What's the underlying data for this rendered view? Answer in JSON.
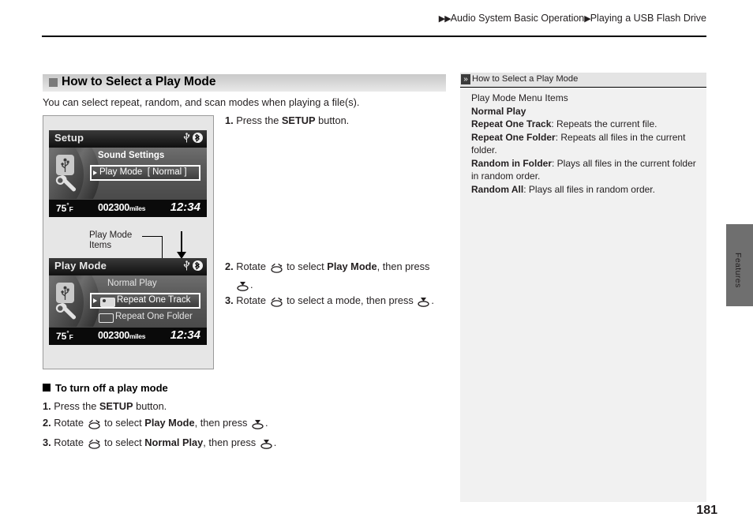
{
  "breadcrumb": {
    "arrow": "▶▶",
    "part1": "Audio System Basic Operation",
    "sep": "▶",
    "part2": "Playing a USB Flash Drive"
  },
  "heading": "How to Select a Play Mode",
  "intro": "You can select repeat, random, and scan modes when playing a file(s).",
  "screens": {
    "one": {
      "title": "Setup",
      "section_label": "Sound Settings",
      "row_label": "Play Mode",
      "row_value": "[  Normal  ]",
      "status": {
        "temp": "75",
        "degree": "°",
        "temp_unit": "F",
        "odometer": "002300",
        "odo_unit": "miles",
        "clock": "12:34"
      }
    },
    "two": {
      "title": "Play Mode",
      "items": [
        {
          "label": "Normal Play",
          "icon": "none",
          "selected": false
        },
        {
          "label": "Repeat One Track",
          "icon": "repeat-one-track-icon",
          "selected": true
        },
        {
          "label": "Repeat One Folder",
          "icon": "repeat-one-folder-icon",
          "selected": false
        }
      ],
      "status": {
        "temp": "75",
        "degree": "°",
        "temp_unit": "F",
        "odometer": "002300",
        "odo_unit": "miles",
        "clock": "12:34"
      }
    }
  },
  "callout": {
    "line1": "Play Mode",
    "line2": "Items"
  },
  "steps": {
    "step1_num": "1.",
    "step1_a": "Press the ",
    "step1_b": "SETUP",
    "step1_c": " button.",
    "step2_num": "2.",
    "step2_a": "Rotate ",
    "step2_b": " to select ",
    "step2_c": "Play Mode",
    "step2_d": ", then press ",
    "step2_e": "",
    "step3_num": "3.",
    "step3_a": "Rotate ",
    "step3_b": " to select a mode, then press ",
    "step3_c": "."
  },
  "turn_off": {
    "heading": "To turn off a play mode",
    "item1_num": "1.",
    "item1_a": "Press the ",
    "item1_b": "SETUP",
    "item1_c": " button.",
    "item2_num": "2.",
    "item2_a": "Rotate ",
    "item2_b": " to select ",
    "item2_c": "Play Mode",
    "item2_d": ", then press ",
    "item2_e": ".",
    "item3_num": "3.",
    "item3_a": "Rotate ",
    "item3_b": " to select ",
    "item3_c": "Normal Play",
    "item3_d": ", then press ",
    "item3_e": "."
  },
  "sidebar": {
    "glyph": "»",
    "header": "How to Select a Play Mode",
    "intro": "Play Mode Menu Items",
    "entries": [
      {
        "term": "Normal Play",
        "desc": ""
      },
      {
        "term": "Repeat One Track",
        "desc": ": Repeats the current file."
      },
      {
        "term": "Repeat One Folder",
        "desc": ": Repeats all files in the current folder."
      },
      {
        "term": "Random in Folder",
        "desc": ": Plays all files in the current folder in random order."
      },
      {
        "term": "Random All",
        "desc": ": Plays all files in random order."
      }
    ]
  },
  "tab_label": "Features",
  "page_number": "181"
}
